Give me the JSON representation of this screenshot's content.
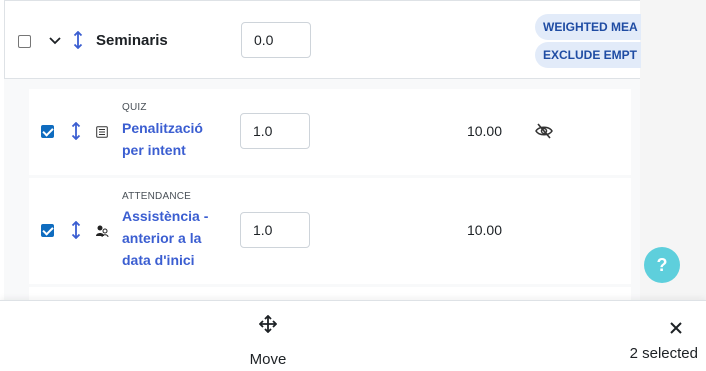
{
  "category": {
    "name": "Seminaris",
    "weight_value": "0.0",
    "badges": [
      "WEIGHTED MEA",
      "EXCLUDE EMPT"
    ]
  },
  "items": [
    {
      "module": "QUIZ",
      "name_lines": [
        "Penalització",
        "per intent"
      ],
      "weight_value": "1.0",
      "max_grade": "10.00",
      "hidden": true
    },
    {
      "module": "ATTENDANCE",
      "name_lines": [
        "Assistència -",
        "anterior a la",
        "data d'inici"
      ],
      "weight_value": "1.0",
      "max_grade": "10.00",
      "hidden": false
    }
  ],
  "help": {
    "label": "?"
  },
  "footer": {
    "move_label": "Move",
    "selected_text": "2 selected"
  },
  "colors": {
    "accent": "#3b5ed1",
    "checkbox": "#0f6cbf",
    "badge_bg": "#e2ebf9",
    "help_bg": "#5ecfdc"
  }
}
